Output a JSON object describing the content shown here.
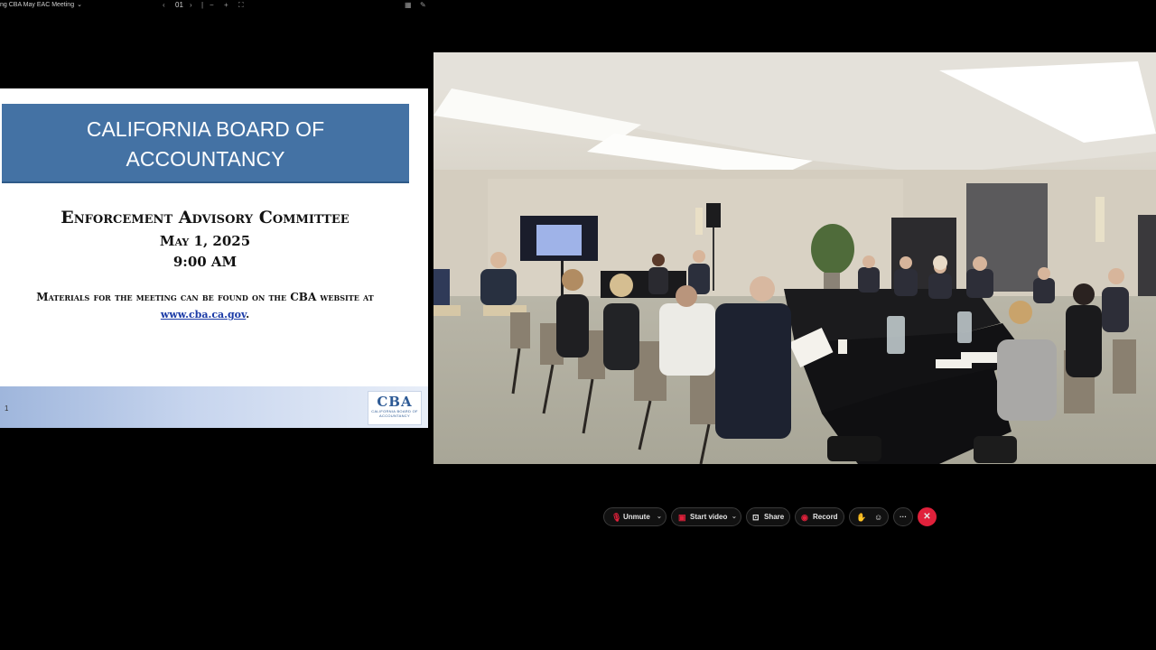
{
  "window": {
    "title": "ng CBA May EAC Meeting",
    "page_counter": "01",
    "controls": [
      "‹",
      "›",
      "−",
      "+",
      "⛶"
    ]
  },
  "slide": {
    "banner_line1": "CALIFORNIA BOARD OF",
    "banner_line2": "ACCOUNTANCY",
    "committee": "Enforcement Advisory Committee",
    "date": "May 1, 2025",
    "time": "9:00 AM",
    "materials": "Materials for the meeting can be found on the CBA website at",
    "link": "www.cba.ca.gov",
    "link_suffix": ".",
    "page_number": "1",
    "logo_text": "CBA",
    "logo_subtext": "CALIFORNIA BOARD OF ACCOUNTANCY"
  },
  "toolbar": {
    "unmute": "Unmute",
    "start_video": "Start video",
    "share": "Share",
    "record": "Record",
    "more": "···"
  },
  "colors": {
    "banner": "#4472a4",
    "end_call": "#e0213b",
    "link": "#1a3aa6"
  }
}
